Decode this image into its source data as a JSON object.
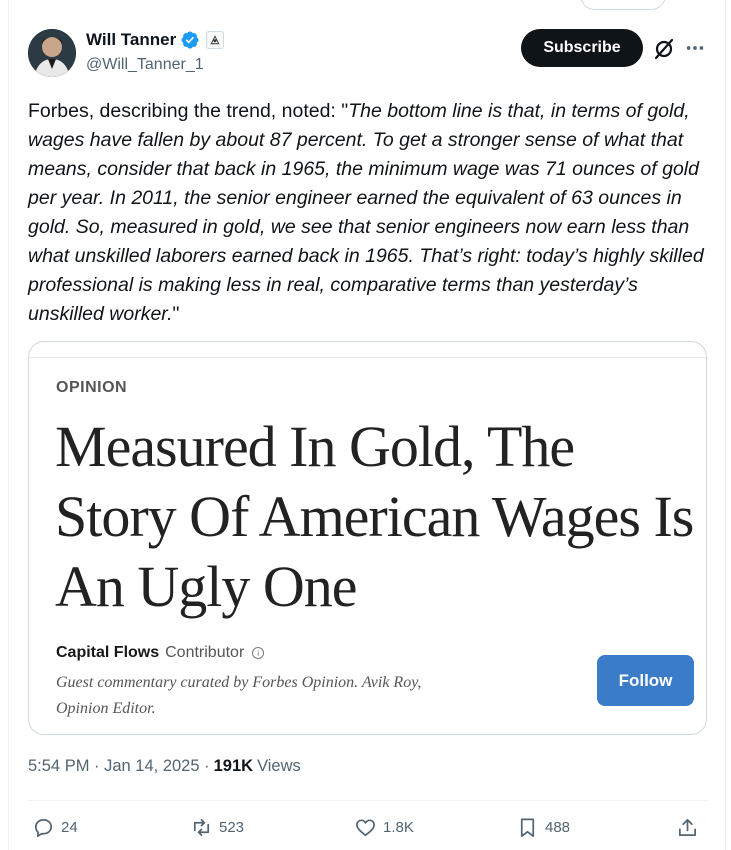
{
  "author": {
    "display_name": "Will Tanner",
    "handle": "@Will_Tanner_1"
  },
  "header_buttons": {
    "subscribe_label": "Subscribe"
  },
  "tweet": {
    "intro": "Forbes, describing the trend, noted: \"",
    "quote": "The bottom line is that, in terms of gold, wages have fallen by about 87 percent. To get a stronger sense of what that means, consider that back in 1965, the minimum wage was 71 ounces of gold per year. In 2011, the senior engineer earned the equivalent of 63 ounces in gold. So, measured in gold, we see that senior engineers now earn less than what unskilled laborers earned back in 1965. That’s right: today’s highly skilled professional is making less in real, comparative terms than yesterday’s unskilled worker.",
    "closing": "\""
  },
  "card": {
    "section": "OPINION",
    "headline": "Measured In Gold, The Story Of American Wages Is An Ugly One",
    "author_name": "Capital Flows",
    "author_role": "Contributor",
    "guest_note": "Guest commentary curated by Forbes Opinion. Avik Roy, Opinion Editor.",
    "follow_label": "Follow"
  },
  "meta": {
    "time": "5:54 PM · Jan 14, 2025 ·",
    "views_count": "191K",
    "views_label": "Views"
  },
  "actions": {
    "replies": "24",
    "reposts": "523",
    "likes": "1.8K",
    "bookmarks": "488"
  },
  "colors": {
    "verified_blue": "#1d9bf0",
    "follow_blue": "#3a7cc8",
    "subscribe_black": "#0f1419",
    "muted_text": "#536471"
  }
}
